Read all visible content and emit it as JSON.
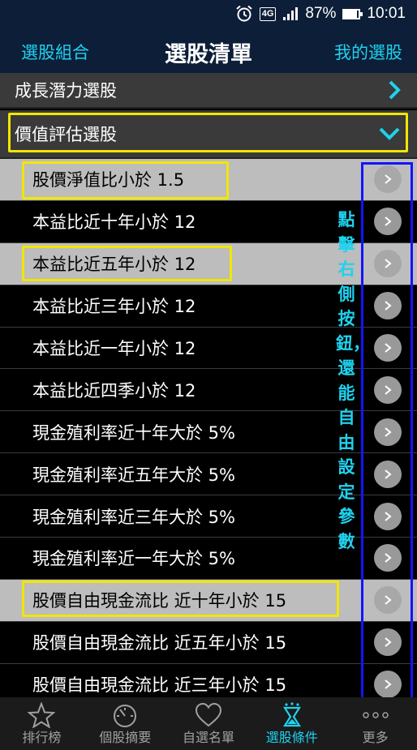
{
  "status_bar": {
    "network": "4G",
    "battery": "87%",
    "battery_level": 0.87,
    "time": "10:01"
  },
  "header": {
    "left": "選股組合",
    "title": "選股清單",
    "right": "我的選股"
  },
  "categories": [
    {
      "label": "成長潛力選股"
    },
    {
      "label": "價值評估選股"
    }
  ],
  "items": [
    {
      "label": "股價淨值比小於 1.5"
    },
    {
      "label": "本益比近十年小於 12"
    },
    {
      "label": "本益比近五年小於 12"
    },
    {
      "label": "本益比近三年小於 12"
    },
    {
      "label": "本益比近一年小於 12"
    },
    {
      "label": "本益比近四季小於 12"
    },
    {
      "label": "現金殖利率近十年大於 5%"
    },
    {
      "label": "現金殖利率近五年大於 5%"
    },
    {
      "label": "現金殖利率近三年大於 5%"
    },
    {
      "label": "現金殖利率近一年大於 5%"
    },
    {
      "label": "股價自由現金流比 近十年小於 15"
    },
    {
      "label": "股價自由現金流比 近五年小於 15"
    },
    {
      "label": "股價自由現金流比 近三年小於 15"
    }
  ],
  "annotation": "點擊右側按鈕，還能自由設定參數",
  "nav": [
    {
      "label": "排行榜",
      "icon": "star-icon"
    },
    {
      "label": "個股摘要",
      "icon": "gauge-icon"
    },
    {
      "label": "自選名單",
      "icon": "heart-icon"
    },
    {
      "label": "選股條件",
      "icon": "hourglass-icon"
    },
    {
      "label": "更多",
      "icon": "more-icon"
    }
  ],
  "colors": {
    "accent": "#1ed2ee",
    "header_bg": "#0d1e38",
    "highlight": "#f2e600",
    "annotation_box": "#1414ff"
  }
}
